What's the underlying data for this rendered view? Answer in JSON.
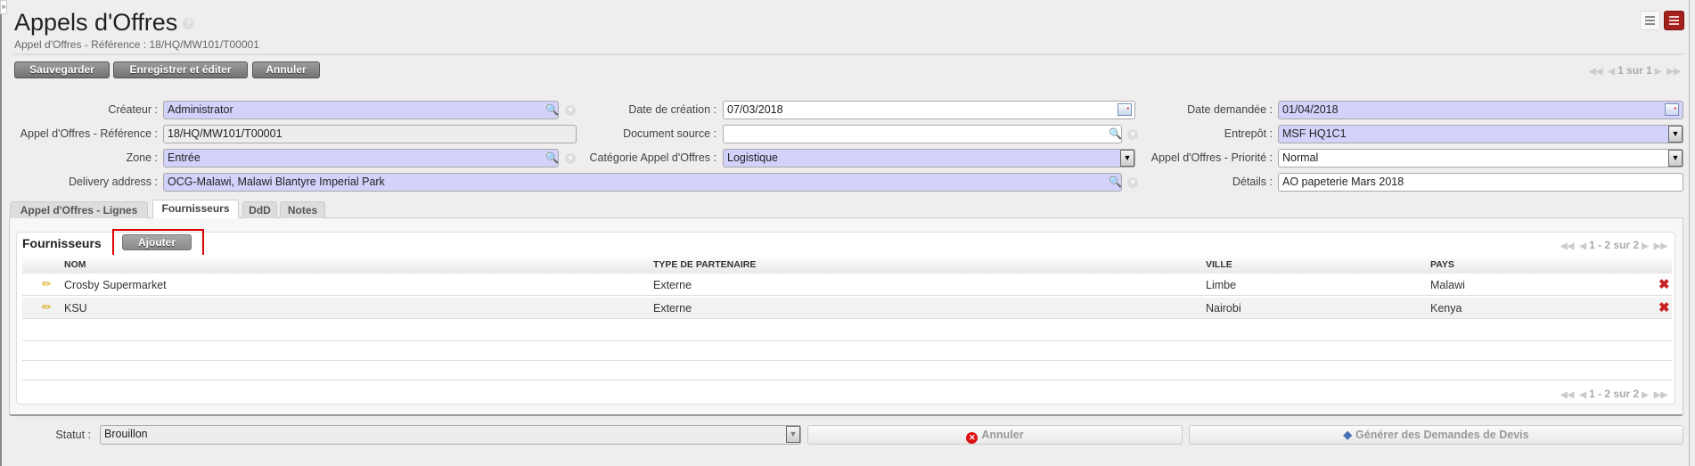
{
  "header": {
    "title": "Appels d'Offres",
    "help": "?",
    "subtitle": "Appel d'Offres - Référence : 18/HQ/MW101/T00001",
    "sidebar_toggle": "»"
  },
  "toolbar": {
    "save": "Sauvegarder",
    "save_edit": "Enregistrer et éditer",
    "cancel": "Annuler"
  },
  "pager": {
    "text": "1 sur 1"
  },
  "form": {
    "createur": {
      "label": "Créateur :",
      "value": "Administrator"
    },
    "reference": {
      "label": "Appel d'Offres - Référence :",
      "value": "18/HQ/MW101/T00001"
    },
    "zone": {
      "label": "Zone :",
      "value": "Entrée"
    },
    "delivery": {
      "label": "Delivery address :",
      "value": "OCG-Malawi, Malawi Blantyre Imperial Park"
    },
    "date_creation": {
      "label": "Date de création :",
      "value": "07/03/2018"
    },
    "document_source": {
      "label": "Document source :",
      "value": ""
    },
    "categorie": {
      "label": "Catégorie Appel d'Offres :",
      "value": "Logistique"
    },
    "date_demandee": {
      "label": "Date demandée :",
      "value": "01/04/2018"
    },
    "entrepot": {
      "label": "Entrepôt :",
      "value": "MSF HQ1C1"
    },
    "priorite": {
      "label": "Appel d'Offres - Priorité :",
      "value": "Normal"
    },
    "details": {
      "label": "Détails :",
      "value": "AO papeterie Mars 2018"
    }
  },
  "tabs": [
    {
      "label": "Appel d'Offres - Lignes"
    },
    {
      "label": "Fournisseurs"
    },
    {
      "label": "DdD"
    },
    {
      "label": "Notes"
    }
  ],
  "suppliers": {
    "title": "Fournisseurs",
    "add": "Ajouter",
    "pager": "1 - 2 sur 2",
    "columns": [
      "NOM",
      "TYPE DE PARTENAIRE",
      "VILLE",
      "PAYS"
    ],
    "rows": [
      {
        "nom": "Crosby Supermarket",
        "type": "Externe",
        "ville": "Limbe",
        "pays": "Malawi"
      },
      {
        "nom": "KSU",
        "type": "Externe",
        "ville": "Nairobi",
        "pays": "Kenya"
      }
    ]
  },
  "footer": {
    "status_label": "Statut :",
    "status_value": "Brouillon",
    "cancel": "Annuler",
    "generate": "Générer des Demandes de Devis"
  },
  "colors": {
    "required_bg": "#d2d2fb",
    "active_view": "#a3201c",
    "highlight": "#e00000"
  }
}
